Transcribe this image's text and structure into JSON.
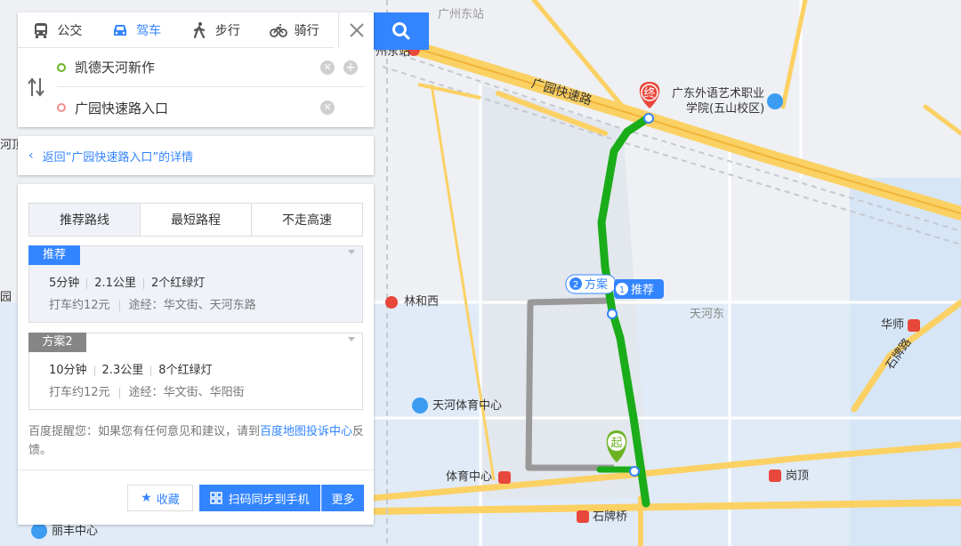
{
  "mode_tabs": [
    {
      "label": "公交",
      "icon": "bus-icon"
    },
    {
      "label": "驾车",
      "icon": "car-icon"
    },
    {
      "label": "步行",
      "icon": "walk-icon"
    },
    {
      "label": "骑行",
      "icon": "bike-icon"
    }
  ],
  "start": {
    "value": "凯德天河新作"
  },
  "end": {
    "value": "广园快速路入口"
  },
  "back": {
    "label": "返回“广园快速路入口”的详情"
  },
  "route_tabs": [
    "推荐路线",
    "最短路程",
    "不走高速"
  ],
  "plans": [
    {
      "badge": "推荐",
      "time": "5分钟",
      "distance": "2.1公里",
      "lights": "2个红绿灯",
      "taxi": "打车约12元",
      "via_label": "途经：",
      "via": "华文街、天河东路"
    },
    {
      "badge": "方案2",
      "time": "10分钟",
      "distance": "2.3公里",
      "lights": "8个红绿灯",
      "taxi": "打车约12元",
      "via_label": "途经：",
      "via": "华文街、华阳街"
    }
  ],
  "notice": {
    "prefix": "百度提醒您：如果您有任何意见和建议，请到",
    "link": "百度地图投诉中心",
    "suffix": "反馈。"
  },
  "actions": {
    "favorite": "收藏",
    "sync": "扫码同步到手机",
    "more": "更多"
  },
  "map_labels": {
    "guangzhou_east": "广州东站",
    "guangzhou_east_2": "州东站",
    "expressway": "广园快速路",
    "school_1": "广东外语艺术职业",
    "school_2": "学院(五山校区)",
    "linhexi": "林和西",
    "tianhedong": "天河东",
    "huashi": "华师",
    "sports_center_poi": "天河体育中心",
    "tiyuzhongxin": "体育中心",
    "gangding": "岗顶",
    "shipaiqiao": "石牌桥",
    "lifeng": "丽丰中心",
    "shipai_road": "石牌路",
    "edge_1": "河顶",
    "edge_2": "园",
    "marker_end": "终",
    "marker_start": "起",
    "plan_tag": "方案",
    "plan_tag_num": "2",
    "rec_tag": "推荐",
    "rec_tag_num": "1"
  },
  "colors": {
    "accent": "#3385ff",
    "route": "#1aad19",
    "alt_route": "#999999",
    "end_marker": "#e8473b",
    "start_marker": "#6bb323",
    "badge_rec": "#3385ff",
    "badge_alt": "#868686",
    "road": "#fbd164"
  }
}
